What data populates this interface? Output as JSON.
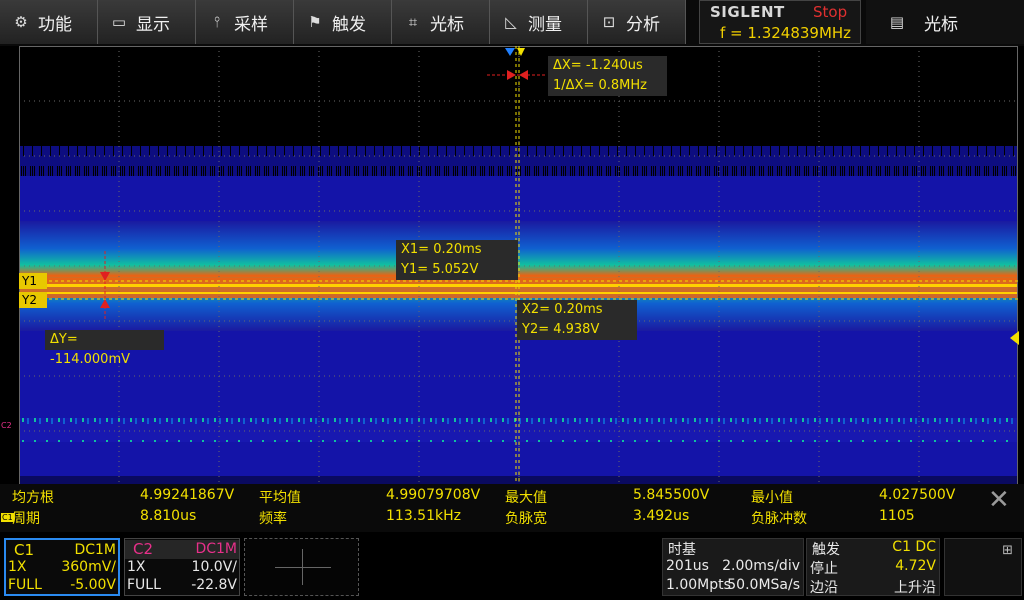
{
  "menu": [
    {
      "label": "功能",
      "icon": "gear-icon"
    },
    {
      "label": "显示",
      "icon": "monitor-icon"
    },
    {
      "label": "采样",
      "icon": "waveform-icon"
    },
    {
      "label": "触发",
      "icon": "flag-icon"
    },
    {
      "label": "光标",
      "icon": "crosshair-icon"
    },
    {
      "label": "测量",
      "icon": "measure-icon"
    },
    {
      "label": "分析",
      "icon": "analysis-icon"
    }
  ],
  "brand": {
    "name": "SIGLENT",
    "run_state": "Stop",
    "frequency": "f = 1.324839MHz"
  },
  "right_menu": {
    "label": "光标",
    "icon": "document-icon"
  },
  "cursors": {
    "dx": "ΔX= -1.240us",
    "inv_dx": "1/ΔX= 0.8MHz",
    "x1": "X1= 0.20ms",
    "y1": "Y1= 5.052V",
    "x2": "X2= 0.20ms",
    "y2": "Y2= 4.938V",
    "dy": "ΔY= -114.000mV",
    "y1_tag": "Y1",
    "y2_tag": "Y2",
    "x_tag": "X",
    "c2_marker": "C2"
  },
  "measurements": {
    "row1": [
      {
        "label": "均方根",
        "value": "4.99241867V"
      },
      {
        "label": "平均值",
        "value": "4.99079708V"
      },
      {
        "label": "最大值",
        "value": "5.845500V"
      },
      {
        "label": "最小值",
        "value": "4.027500V"
      }
    ],
    "row2": [
      {
        "label": "周期",
        "value": "8.810us"
      },
      {
        "label": "频率",
        "value": "113.51kHz"
      },
      {
        "label": "负脉宽",
        "value": "3.492us"
      },
      {
        "label": "负脉冲数",
        "value": "1105"
      }
    ],
    "c1_tag": "C1"
  },
  "channels": {
    "c1": {
      "name": "C1",
      "coupling": "DC1M",
      "probe": "1X",
      "scale": "360mV/",
      "bw": "FULL",
      "offset": "-5.00V",
      "color": "#f2e000"
    },
    "c2": {
      "name": "C2",
      "coupling": "DC1M",
      "probe": "1X",
      "scale": "10.0V/",
      "bw": "FULL",
      "offset": "-22.8V",
      "color": "#e8308a"
    }
  },
  "timebase": {
    "title": "时基",
    "position": "201us",
    "scale": "2.00ms/div",
    "memory": "1.00Mpts",
    "rate": "50.0MSa/s"
  },
  "trigger": {
    "title": "触发",
    "source": "C1 DC",
    "state": "停止",
    "level": "4.72V",
    "type": "边沿",
    "slope": "上升沿"
  }
}
